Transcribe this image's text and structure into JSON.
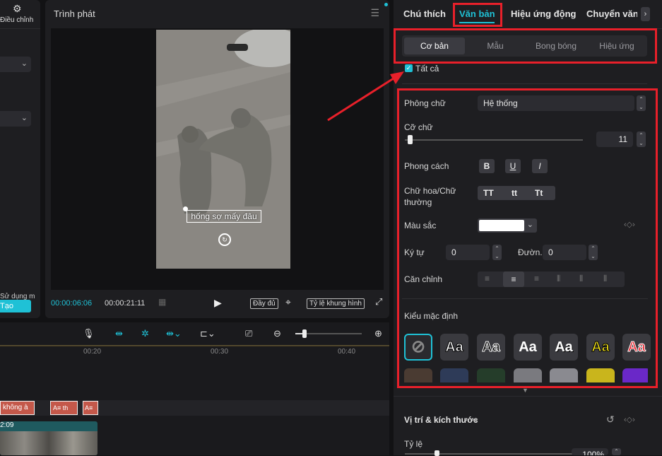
{
  "left_panel": {
    "adjust_label": "Điều chỉnh",
    "use_label": "Sử dụng m",
    "create_button": "Tạo"
  },
  "player": {
    "title": "Trình phát",
    "caption_text": "hống sợ mấy đâu",
    "current_time": "00:00:06:06",
    "total_time": "00:00:21:11",
    "full_button": "Đầy đủ",
    "ratio_button": "Tỷ lệ khung hình"
  },
  "timeline": {
    "ticks": [
      "00:20",
      "00:30",
      "00:40"
    ],
    "clip_label": "không à",
    "text_clip_a": "A≡ th",
    "text_clip_b": "A≡",
    "video_time": "2:09"
  },
  "right_panel": {
    "tabs": [
      "Chú thích",
      "Văn bản",
      "Hiệu ứng động",
      "Chuyển văn b"
    ],
    "subtabs": [
      "Cơ bản",
      "Mẫu",
      "Bong bóng",
      "Hiệu ứng"
    ],
    "select_all": "Tất cả",
    "font_label": "Phông chữ",
    "font_value": "Hệ thống",
    "size_label": "Cỡ chữ",
    "size_value": "11",
    "style_label": "Phong cách",
    "style_buttons": [
      "B",
      "U",
      "I"
    ],
    "case_label": "Chữ hoa/Chữ thường",
    "case_buttons": [
      "TT",
      "tt",
      "Tt"
    ],
    "color_label": "Màu sắc",
    "char_label": "Ký tự",
    "char_value": "0",
    "line_label": "Đườn...",
    "line_value": "0",
    "align_label": "Căn chỉnh",
    "preset_label": "Kiểu mặc định",
    "preset_glyph": "Aa",
    "position_section": "Vị trí & kích thước",
    "scale_label": "Tỷ lệ",
    "scale_value": "100%"
  },
  "colors": {
    "accent": "#1fc1d6",
    "annotation_red": "#e8202a",
    "panel_bg": "#1e1e21"
  }
}
